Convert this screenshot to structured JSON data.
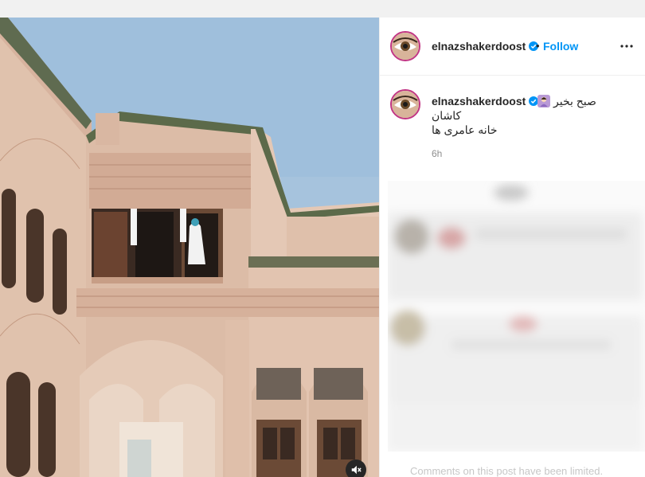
{
  "post": {
    "author": {
      "username": "elnazshakerdoost",
      "verified_icon": "verified-badge-icon",
      "avatar_icon": "avatar-eye-icon"
    },
    "header": {
      "separator": "•",
      "follow_label": "Follow",
      "more_icon": "more-options-icon"
    },
    "caption": {
      "username": "elnazshakerdoost",
      "emoji_icon": "woman-emoji-icon",
      "line1": "صبح بخیر",
      "line2": "کاشان",
      "line3": "خانه عامری ها",
      "time": "6h"
    },
    "media": {
      "mute_icon": "muted-speaker-icon"
    },
    "comments": {
      "limited_notice": "Comments on this post have been limited."
    }
  },
  "colors": {
    "accent": "#0095f6",
    "text": "#262626",
    "muted": "#8e8e8e",
    "story_ring": "#c13584"
  }
}
